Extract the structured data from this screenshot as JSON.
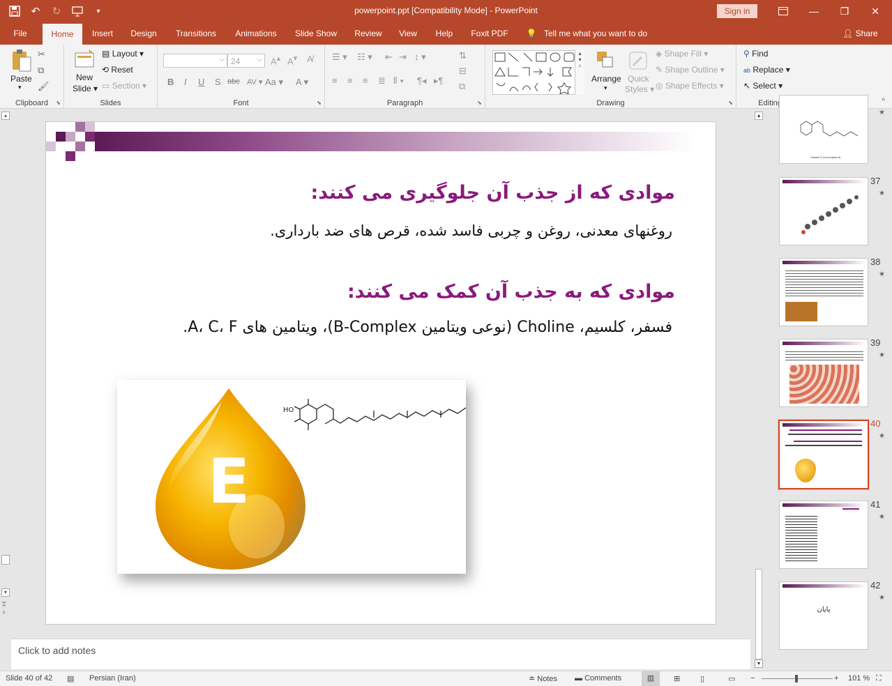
{
  "window": {
    "title": "powerpoint.ppt [Compatibility Mode]  -  PowerPoint",
    "signin": "Sign in"
  },
  "tabs": [
    "File",
    "Home",
    "Insert",
    "Design",
    "Transitions",
    "Animations",
    "Slide Show",
    "Review",
    "View",
    "Help",
    "Foxit PDF"
  ],
  "tell_me": "Tell me what you want to do",
  "share": "Share",
  "ribbon": {
    "clipboard": {
      "label": "Clipboard",
      "paste": "Paste"
    },
    "slides": {
      "label": "Slides",
      "new_slide_1": "New",
      "new_slide_2": "Slide",
      "layout": "Layout",
      "reset": "Reset",
      "section": "Section"
    },
    "font": {
      "label": "Font",
      "size": "24"
    },
    "paragraph": {
      "label": "Paragraph"
    },
    "drawing": {
      "label": "Drawing",
      "arrange": "Arrange",
      "quick_styles_1": "Quick",
      "quick_styles_2": "Styles",
      "shape_fill": "Shape Fill",
      "shape_outline": "Shape Outline",
      "shape_effects": "Shape Effects"
    },
    "editing": {
      "label": "Editing",
      "find": "Find",
      "replace": "Replace",
      "select": "Select"
    }
  },
  "slide": {
    "heading1": "موادی که از جذب آن جلوگیری می کنند:",
    "body1": "روغنهای معدنی، روغن و چربی فاسد شده، قرص های ضد بارداری.",
    "heading2": "موادی که به جذب آن کمک می کنند:",
    "body2": "فسفر، کلسیم، Choline (نوعی ویتامین B-Complex)، ویتامین های A، C، F.",
    "image_letter": "E",
    "image_label": "HO"
  },
  "thumbnails": [
    {
      "num": "",
      "caption": "Vitamin E (α-tocopherol)"
    },
    {
      "num": "37",
      "caption": ""
    },
    {
      "num": "38",
      "caption": ""
    },
    {
      "num": "39",
      "caption": ""
    },
    {
      "num": "40",
      "caption": ""
    },
    {
      "num": "41",
      "caption": ""
    },
    {
      "num": "42",
      "caption": "پایان"
    }
  ],
  "notes": {
    "placeholder": "Click to add notes"
  },
  "status": {
    "slide": "Slide 40 of 42",
    "language": "Persian (Iran)",
    "notes": "Notes",
    "comments": "Comments",
    "zoom": "101 %"
  },
  "colors": {
    "accent": "#b7472a",
    "heading": "#8a1a7c",
    "selected_thumb": "#d24726"
  }
}
